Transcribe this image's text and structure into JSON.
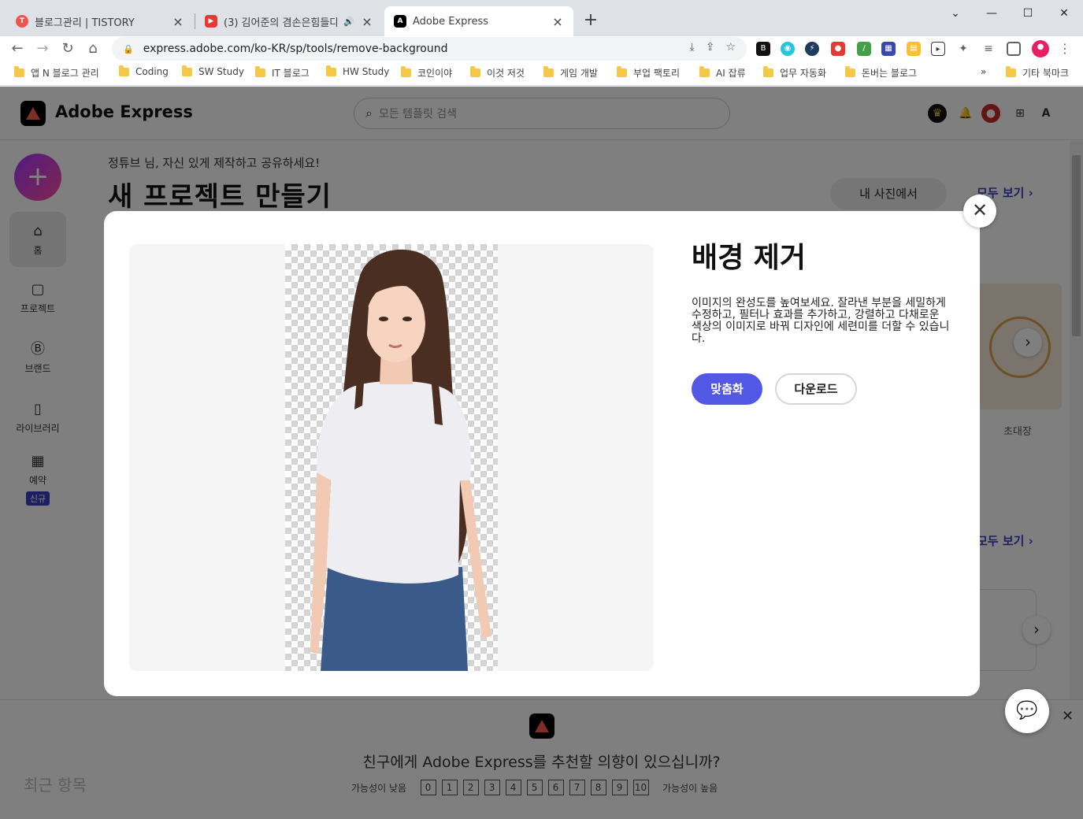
{
  "browser": {
    "tabs": [
      {
        "title": "블로그관리 | TISTORY",
        "favicon": "tistory-icon",
        "active": false
      },
      {
        "title": "(3) 김어준의 겸손은힘들다",
        "favicon": "youtube-icon",
        "active": false
      },
      {
        "title": "Adobe Express",
        "favicon": "adobe-express-icon",
        "active": true
      }
    ],
    "url": "express.adobe.com/ko-KR/sp/tools/remove-background",
    "bookmarks": [
      "앱 N 블로그 관리",
      "Coding",
      "SW Study",
      "IT 블로그",
      "HW Study",
      "코인이야",
      "이것 저것",
      "게임 개발",
      "부업 팩토리",
      "AI 잡류",
      "업무 자동화",
      "돈버는 블로그"
    ],
    "bookmarks_more": "»",
    "other_bookmarks": "기타 북마크"
  },
  "app": {
    "brand": "Adobe Express",
    "search_placeholder": "모든 템플릿 검색",
    "sidebar": [
      {
        "label": "홈",
        "icon": "home-icon"
      },
      {
        "label": "프로젝트",
        "icon": "file-icon"
      },
      {
        "label": "브랜드",
        "icon": "brand-icon"
      },
      {
        "label": "라이브러리",
        "icon": "library-icon"
      },
      {
        "label": "예약",
        "icon": "calendar-icon",
        "badge": "신규"
      }
    ],
    "greeting": "정튜브 님, 자신 있게 제작하고 공유하세요!",
    "headline": "새 프로젝트 만들기",
    "my_photos": "내 사진에서",
    "see_all": "모두 보기 ›",
    "card_invitation_label": "초대장",
    "recent": "최근 항목"
  },
  "modal": {
    "title": "배경 제거",
    "description": "이미지의 완성도를 높여보세요. 잘라낸 부분을 세밀하게 수정하고, 필터나 효과를 추가하고, 강렬하고 다채로운 색상의 이미지로 바꿔 디자인에 세련미를 더할 수 있습니다.",
    "customize": "맞춤화",
    "download": "다운로드"
  },
  "survey": {
    "question": "친구에게 Adobe Express를 추천할 의향이 있으십니까?",
    "low": "가능성이 낮음",
    "high": "가능성이 높음",
    "scale": [
      "0",
      "1",
      "2",
      "3",
      "4",
      "5",
      "6",
      "7",
      "8",
      "9",
      "10"
    ]
  },
  "colors": {
    "accent": "#5258e4",
    "brand_purple": "#3b3fc5"
  }
}
